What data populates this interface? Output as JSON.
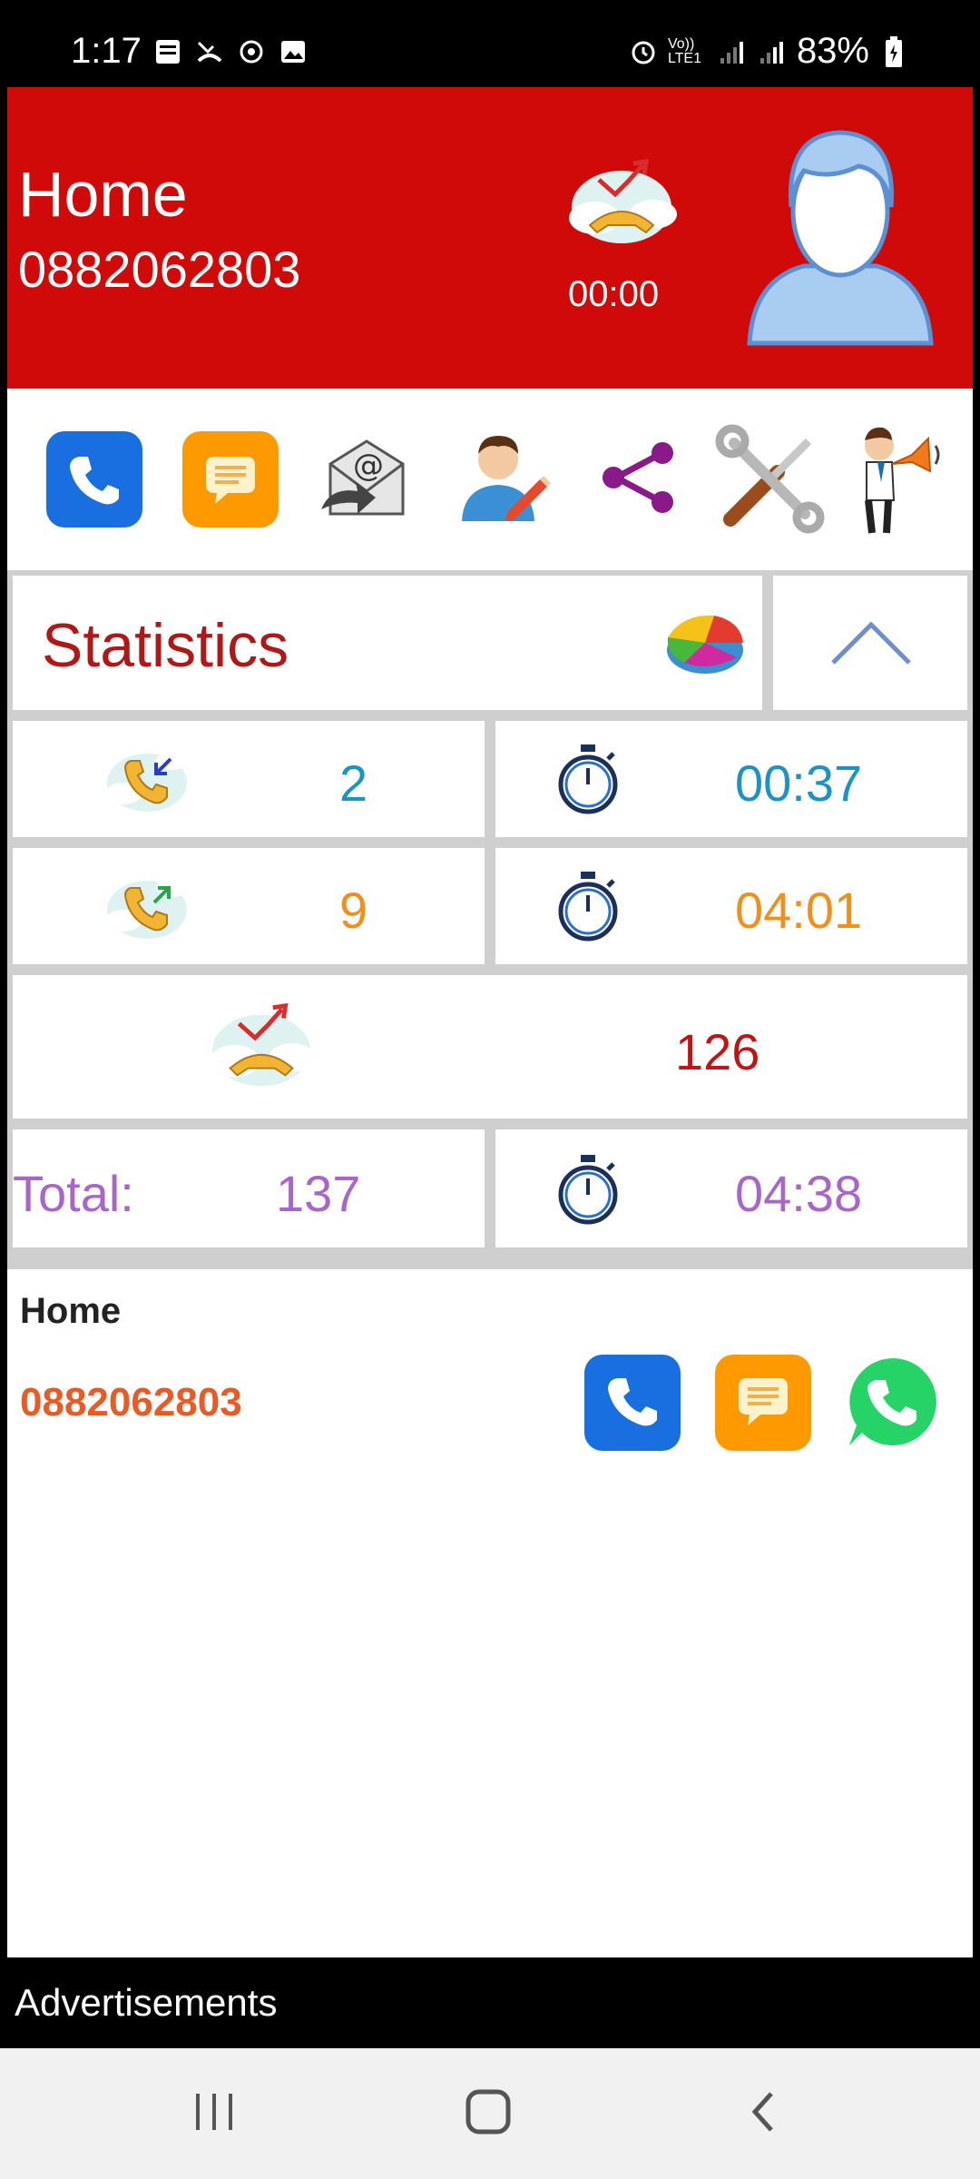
{
  "status_bar": {
    "time": "1:17",
    "battery": "83%",
    "icons_left": [
      "holy-bible-icon",
      "missed-call-icon",
      "sync-icon",
      "image-icon"
    ],
    "icons_right": [
      "alarm-icon",
      "volte-icon",
      "signal-icon",
      "signal-icon",
      "battery-icon"
    ],
    "volte_label": "Vo)) LTE1"
  },
  "header": {
    "name": "Home",
    "number": "0882062803",
    "call_duration": "00:00",
    "background_color": "#d00909"
  },
  "actions": [
    {
      "name": "call-button",
      "icon": "phone-icon",
      "color": "#1a6fe0"
    },
    {
      "name": "message-button",
      "icon": "message-icon",
      "color": "#ff9900"
    },
    {
      "name": "email-button",
      "icon": "email-icon"
    },
    {
      "name": "edit-contact-button",
      "icon": "edit-contact-icon"
    },
    {
      "name": "share-button",
      "icon": "share-icon",
      "color": "#8a1a8a"
    },
    {
      "name": "settings-button",
      "icon": "tools-icon"
    },
    {
      "name": "announce-button",
      "icon": "megaphone-icon"
    }
  ],
  "statistics": {
    "title": "Statistics",
    "incoming_count": "2",
    "incoming_duration": "00:37",
    "outgoing_count": "9",
    "outgoing_duration": "04:01",
    "missed_count": "126",
    "total_label": "Total:",
    "total_count": "137",
    "total_duration": "04:38",
    "colors": {
      "incoming": "#1c93c8",
      "outgoing": "#f0901c",
      "missed": "#c01515",
      "total": "#a866c8"
    }
  },
  "detail": {
    "name": "Home",
    "number": "0882062803"
  },
  "ads": {
    "label": "Advertisements"
  }
}
